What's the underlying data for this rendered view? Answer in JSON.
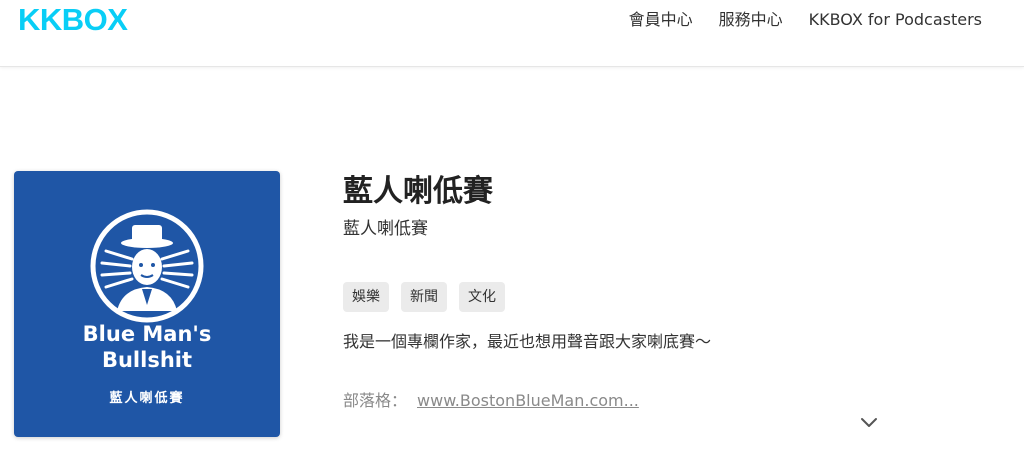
{
  "header": {
    "logo": "KKBOX",
    "nav": [
      {
        "label": "會員中心"
      },
      {
        "label": "服務中心"
      },
      {
        "label": "KKBOX for Podcasters"
      }
    ]
  },
  "cover": {
    "line1": "Blue Man's",
    "line2": "Bullshit",
    "line3": "藍人喇低賽",
    "background": "#1f56a6"
  },
  "podcast": {
    "title": "藍人喇低賽",
    "author": "藍人喇低賽",
    "tags": [
      "娛樂",
      "新聞",
      "文化"
    ],
    "description": "我是一個專欄作家，最近也想用聲音跟大家喇底賽～",
    "blog_label": "部落格：",
    "blog_link": "www.BostonBlueMan.com..."
  },
  "icons": {
    "expand": "chevron-down-icon"
  },
  "colors": {
    "brand": "#09cef6",
    "cover_blue": "#1f56a6",
    "tag_bg": "#ebebeb"
  }
}
